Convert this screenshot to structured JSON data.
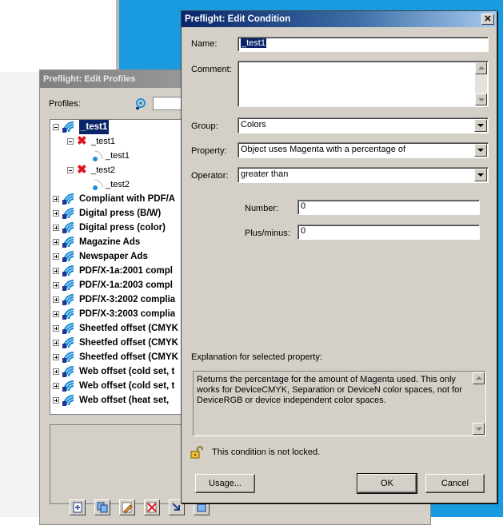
{
  "profiles_window": {
    "title": "Preflight: Edit Profiles",
    "profiles_label": "Profiles:",
    "tree": [
      {
        "label": "_test1",
        "level": 0,
        "kind": "profile",
        "bold": true,
        "selected": true,
        "expanded": true
      },
      {
        "label": "_test1",
        "level": 1,
        "kind": "check",
        "expanded": true
      },
      {
        "label": "_test1",
        "level": 2,
        "kind": "condition"
      },
      {
        "label": "_test2",
        "level": 1,
        "kind": "check",
        "expanded": true
      },
      {
        "label": "_test2",
        "level": 2,
        "kind": "condition"
      },
      {
        "label": "Compliant with PDF/A",
        "level": 0,
        "kind": "profile",
        "bold": true
      },
      {
        "label": "Digital press (B/W)",
        "level": 0,
        "kind": "profile",
        "bold": true
      },
      {
        "label": "Digital press (color)",
        "level": 0,
        "kind": "profile",
        "bold": true
      },
      {
        "label": "Magazine Ads",
        "level": 0,
        "kind": "profile",
        "bold": true
      },
      {
        "label": "Newspaper Ads",
        "level": 0,
        "kind": "profile",
        "bold": true
      },
      {
        "label": "PDF/X-1a:2001 compl",
        "level": 0,
        "kind": "profile",
        "bold": true
      },
      {
        "label": "PDF/X-1a:2003 compl",
        "level": 0,
        "kind": "profile",
        "bold": true
      },
      {
        "label": "PDF/X-3:2002 complia",
        "level": 0,
        "kind": "profile",
        "bold": true
      },
      {
        "label": "PDF/X-3:2003 complia",
        "level": 0,
        "kind": "profile",
        "bold": true
      },
      {
        "label": "Sheetfed offset (CMYK",
        "level": 0,
        "kind": "profile",
        "bold": true
      },
      {
        "label": "Sheetfed offset (CMYK",
        "level": 0,
        "kind": "profile",
        "bold": true
      },
      {
        "label": "Sheetfed offset (CMYK",
        "level": 0,
        "kind": "profile",
        "bold": true
      },
      {
        "label": "Web offset (cold set, t",
        "level": 0,
        "kind": "profile",
        "bold": true
      },
      {
        "label": "Web offset (cold set, t",
        "level": 0,
        "kind": "profile",
        "bold": true
      },
      {
        "label": "Web offset (heat set,",
        "level": 0,
        "kind": "profile",
        "bold": true
      }
    ]
  },
  "condition_dialog": {
    "title": "Preflight: Edit Condition",
    "close_glyph": "✕",
    "name_label": "Name:",
    "name_value": "_test1",
    "comment_label": "Comment:",
    "comment_value": "",
    "group_label": "Group:",
    "group_value": "Colors",
    "property_label": "Property:",
    "property_value": "Object uses Magenta with a percentage of",
    "operator_label": "Operator:",
    "operator_value": "greater than",
    "number_label": "Number:",
    "number_value": "0",
    "plusminus_label": "Plus/minus:",
    "plusminus_value": "0",
    "explanation_label": "Explanation for selected property:",
    "explanation_text": "Returns the percentage for the amount of Magenta used. This only works for DeviceCMYK, Separation or DeviceN color spaces, not for DeviceRGB or device independent color spaces.",
    "lock_status": "This condition is not locked.",
    "usage_button": "Usage...",
    "ok_button": "OK",
    "cancel_button": "Cancel"
  },
  "colors": {
    "title_active": "#0a246a",
    "desktop_blue": "#1a9be0",
    "dialog_face": "#d4d0c8",
    "error_red": "#e0141e"
  }
}
